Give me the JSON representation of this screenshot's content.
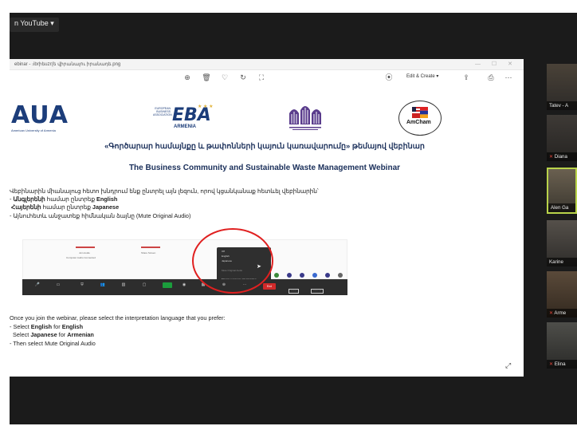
{
  "topbar": {
    "chip_label": "n YouTube ▾"
  },
  "viewer": {
    "title": "ebinar - ։ibrիեuzr(ե վիրանալու իրանադե.png",
    "window_controls": "—  ☐  ✕",
    "edit_label": "Edit & Create ▾"
  },
  "slide": {
    "aua_logo": "AUA",
    "aua_sub": "American University of Armenia",
    "eba_small": "EUROPEAN BUSINESS ASSOCIATION",
    "eba_logo": "EBA",
    "eba_country": "ARMENIA",
    "amcham_logo": "AmCham",
    "armenian_title": "«Գործարար համայնքը և թափոնների կայուն կառավարումը» թեմայով վեբինար",
    "english_title": "The Business Community and Sustainable Waste Management Webinar",
    "armenian_instructions": [
      {
        "pre": "Վեբինարին միանալուց հետո խնդրում ենք ընտրել այն լեզուն, որով կցանկանաք հետևել վեբինարին՝",
        "bold": "",
        "post": ""
      },
      {
        "pre": "- ",
        "bold": "Անգլերենի",
        "post": " համար ընտրեք ",
        "bold2": "English"
      },
      {
        "pre": "  ",
        "bold": "Հայերենի",
        "post": " համար ընտրեք ",
        "bold2": "Japanese"
      },
      {
        "pre": "- Այնուհետև անջատեք հիմնական ձայնը (Mute Original Audio)",
        "bold": "",
        "post": ""
      }
    ],
    "english_instructions": {
      "line1": "Once you join the webinar, please select the interpretation language that you prefer:",
      "line2_pre": "- Select ",
      "line2_b1": "English",
      "line2_mid": " for ",
      "line2_b2": "English",
      "line3_pre": "  Select ",
      "line3_b1": "Japanese",
      "line3_mid": " for ",
      "line3_b2": "Armenian",
      "line4": "- Then select Mute Original Audio"
    }
  },
  "zoom_mock": {
    "popup_items": [
      "Off",
      "English",
      "Japanese",
      "Mute Original Audio",
      "Manage Language Interpretation..."
    ],
    "end_label": "End"
  },
  "participants": [
    {
      "name": "Tatev - A"
    },
    {
      "name": "Diana"
    },
    {
      "name": "Alen Ga"
    },
    {
      "name": "Karine"
    },
    {
      "name": "Arme"
    },
    {
      "name": "Elina"
    }
  ],
  "colors": {
    "accent_highlight": "#b9d34a",
    "annotation_red": "#e02020",
    "brand_navy": "#1a2f5a"
  }
}
